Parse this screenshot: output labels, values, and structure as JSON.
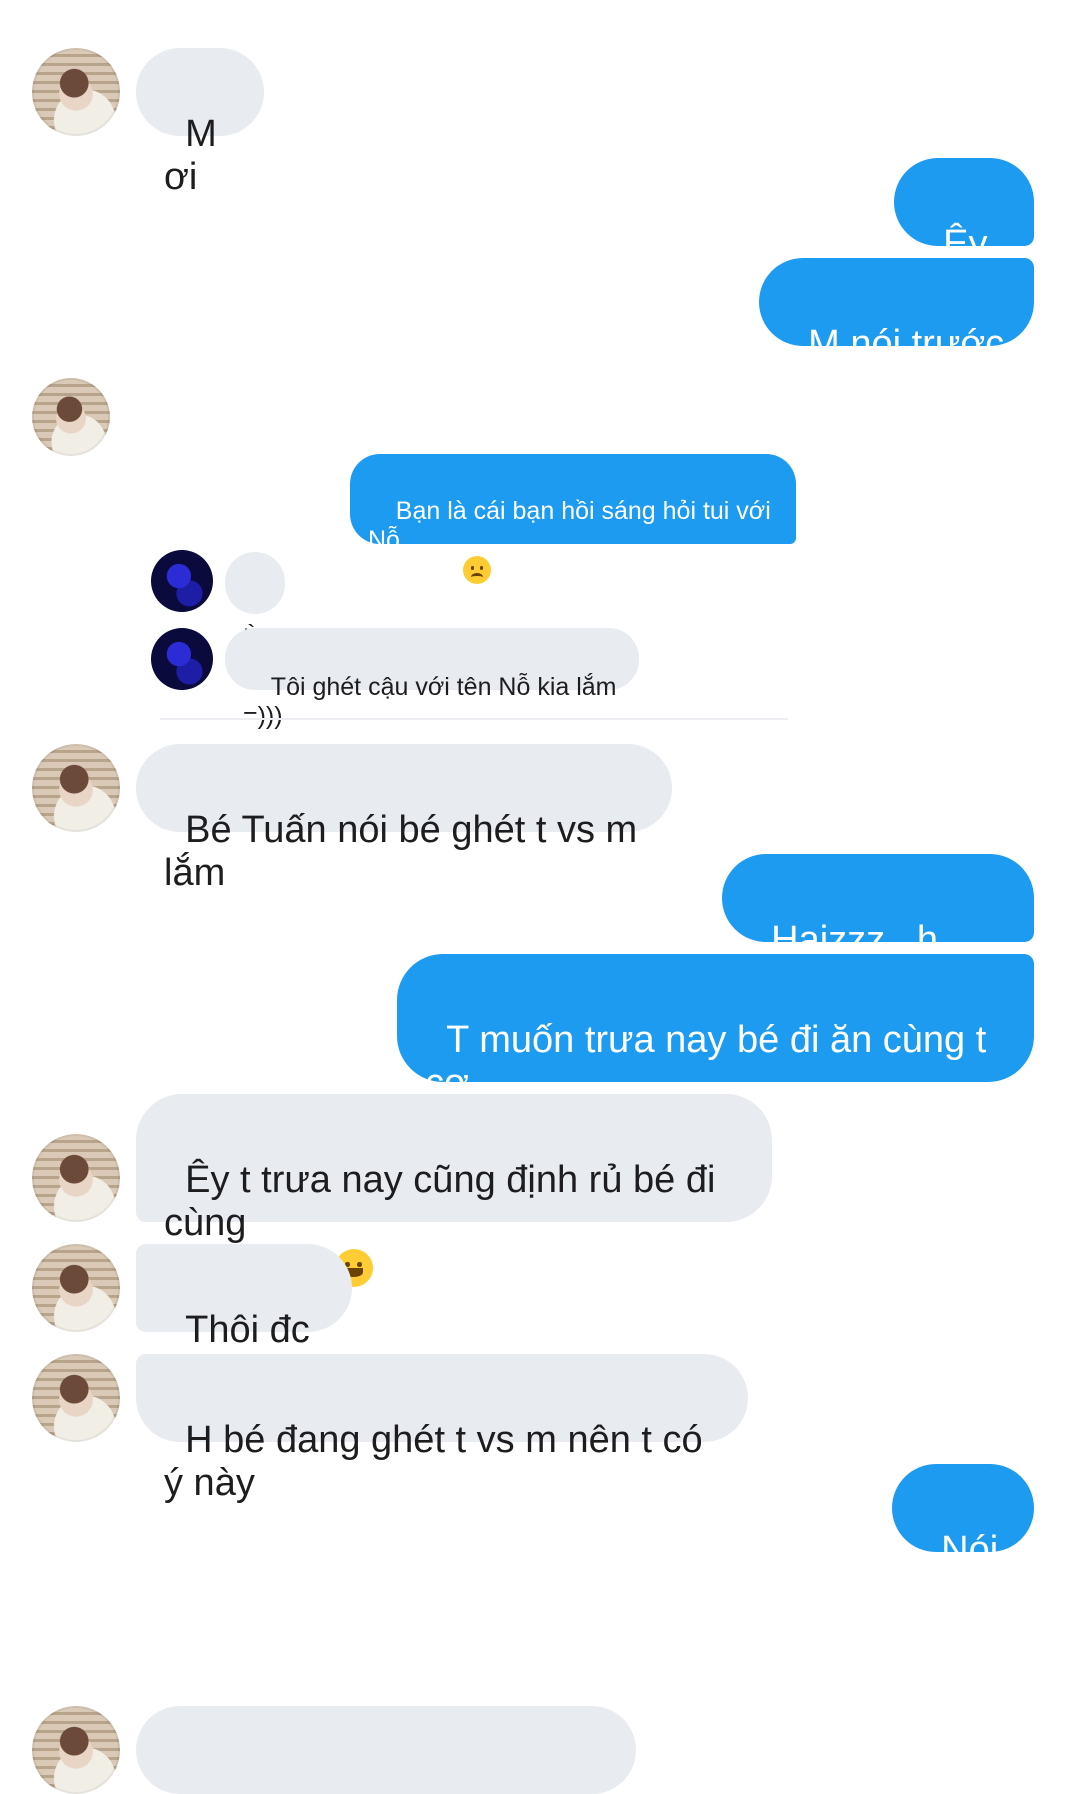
{
  "messages": [
    {
      "id": "m1",
      "side": "received",
      "text": "M ơi"
    },
    {
      "id": "m2",
      "side": "sent",
      "text": "Êy cu"
    },
    {
      "id": "m3",
      "side": "sent",
      "text": "M nói trước đi"
    },
    {
      "id": "m4",
      "side": "sent",
      "text": "Haizzz , h sao m"
    },
    {
      "id": "m5",
      "side": "sent",
      "text": "T muốn trưa nay bé đi ăn cùng t cơ"
    },
    {
      "id": "m6",
      "side": "received",
      "text": "Bé Tuấn nói bé ghét t vs m lắm"
    },
    {
      "id": "m7",
      "side": "received",
      "text": "Êy t trưa nay cũng định rủ bé đi cùng\nnhé tk kia"
    },
    {
      "id": "m8",
      "side": "received",
      "text": "Thôi đc rồi"
    },
    {
      "id": "m9",
      "side": "received",
      "text": "H bé đang ghét t vs m nên t có ý này"
    },
    {
      "id": "m10",
      "side": "sent",
      "text": "Nói đi"
    }
  ],
  "embedded_screenshot": {
    "sent_text": "Bạn là cái bạn hồi sáng hỏi tui với Nỗ\nđúng ko",
    "reply_1": "Ừ",
    "reply_2": "Tôi ghét cậu với tên Nỗ kia lắm =)))"
  },
  "emojis": {
    "disappointed": "disappointed-face",
    "grinning": "grinning-face"
  },
  "colors": {
    "sent_bubble": "#1d9bf0",
    "received_bubble": "#e8ebef",
    "background": "#ffffff"
  }
}
